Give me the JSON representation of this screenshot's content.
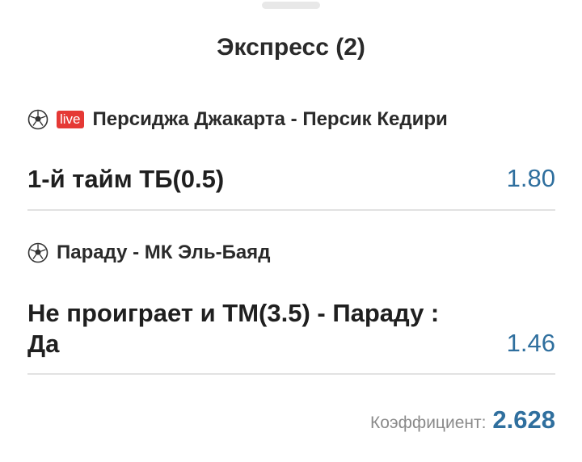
{
  "header": {
    "title": "Экспресс (2)"
  },
  "events": [
    {
      "live_badge": "live",
      "match": "Персиджа Джакарта - Персик Кедири",
      "bet": "1-й тайм ТБ(0.5)",
      "odds": "1.80"
    },
    {
      "match": "Параду - МК Эль-Баяд",
      "bet_line1": "Не проиграет и ТМ(3.5) - Параду :",
      "bet_line2": "Да",
      "odds": "1.46"
    }
  ],
  "summary": {
    "label": "Коэффициент:",
    "value": "2.628"
  },
  "icons": {
    "sport": "soccer-ball-icon"
  },
  "colors": {
    "accent": "#2f6f9e",
    "live": "#e53935",
    "divider": "#e2e2e2"
  }
}
